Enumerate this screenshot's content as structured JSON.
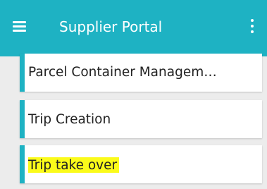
{
  "appbar": {
    "title": "Supplier Portal",
    "menu_icon": "hamburger-menu-icon",
    "more_icon": "more-vertical-icon",
    "color": "#1eb2c3"
  },
  "list": {
    "items": [
      {
        "label": "Parcel Container Managem…"
      },
      {
        "label": "Trip Creation"
      },
      {
        "label": "Trip take over",
        "highlight_color": "#fbfb1a"
      }
    ],
    "accent_color": "#1eb2c3"
  }
}
